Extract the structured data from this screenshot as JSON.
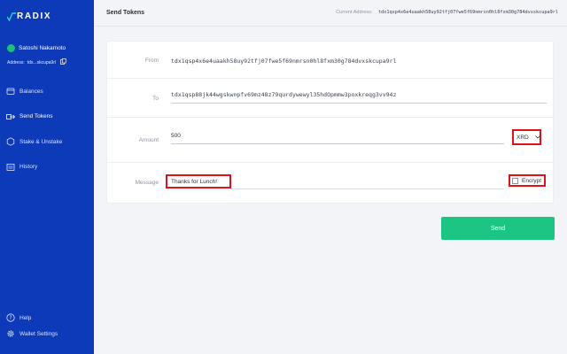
{
  "app": {
    "logo_text": "RADIX"
  },
  "profile": {
    "name": "Satoshi Nakamoto",
    "address_label": "Address:",
    "address_short": "tdx...skcupa9rl"
  },
  "nav": [
    {
      "label": "Balances",
      "icon": "balances-icon"
    },
    {
      "label": "Send Tokens",
      "icon": "send-tokens-icon"
    },
    {
      "label": "Stake & Unstake",
      "icon": "stake-icon"
    },
    {
      "label": "History",
      "icon": "history-icon"
    }
  ],
  "bottom_nav": [
    {
      "label": "Help",
      "icon": "help-icon"
    },
    {
      "label": "Wallet Settings",
      "icon": "gear-icon"
    }
  ],
  "header": {
    "title": "Send Tokens",
    "current_address_label": "Current Address:",
    "current_address": "tdx1qsp4x6e4uaakh58uy92tfj07fwe5f69nmrsn0hl8fxm30g784dvxskcupa9rl"
  },
  "form": {
    "from_label": "From",
    "from_value": "tdx1qsp4x6e4uaakh58uy92tfj07fwe5f69nmrsn0hl8fxm30g784dvxskcupa9rl",
    "to_label": "To",
    "to_value": "tdx1qsp88jk44wgskwnpfv69mz48z79qurdywewyl35hdOpmmw3poxkreqg3vv94z",
    "amount_label": "Amount",
    "amount_value": "500",
    "token": "XRD",
    "message_label": "Message",
    "message_value": "Thanks for Lunch!",
    "encrypt_label": "Encrypt"
  },
  "actions": {
    "send_label": "Send"
  },
  "colors": {
    "sidebar": "#0c3ab8",
    "accent": "#1cc584",
    "highlight": "#e0111a"
  }
}
